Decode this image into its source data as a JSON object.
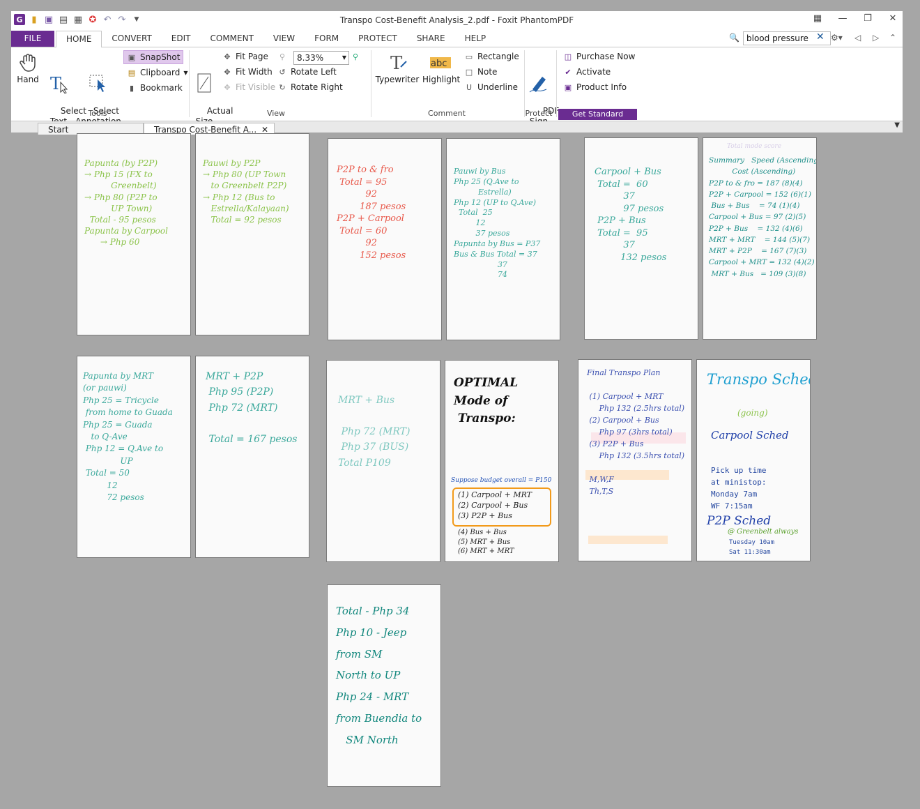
{
  "window": {
    "title": "Transpo Cost-Benefit Analysis_2.pdf - Foxit PhantomPDF",
    "app_icon": "G"
  },
  "menu": {
    "file": "FILE",
    "tabs": [
      "HOME",
      "CONVERT",
      "EDIT",
      "COMMENT",
      "VIEW",
      "FORM",
      "PROTECT",
      "SHARE",
      "HELP"
    ],
    "search_value": "blood pressure"
  },
  "ribbon": {
    "hand": "Hand",
    "select_text": "Select\nText",
    "select_annotation": "Select\nAnnotation",
    "snapshot": "SnapShot",
    "clipboard": "Clipboard",
    "bookmark": "Bookmark",
    "tools_group": "Tools",
    "actual_size": "Actual\nSize",
    "fit_page": "Fit Page",
    "fit_width": "Fit Width",
    "fit_visible": "Fit Visible",
    "zoom": "8.33%",
    "rotate_left": "Rotate Left",
    "rotate_right": "Rotate Right",
    "view_group": "View",
    "typewriter": "Typewriter",
    "highlight": "Highlight",
    "rectangle": "Rectangle",
    "note": "Note",
    "underline": "Underline",
    "comment_group": "Comment",
    "pdf_sign": "PDF\nSign",
    "protect_group": "Protect",
    "purchase_now": "Purchase Now",
    "activate": "Activate",
    "product_info": "Product Info",
    "get_standard": "Get Standard"
  },
  "doc_tabs": {
    "start": "Start",
    "document": "Transpo Cost-Benefit A..."
  },
  "pages": {
    "p1": "Papunta (by P2P)\n→ Php 15 (FX to\n          Greenbelt)\n→ Php 80 (P2P to\n          UP Town)\n  Total - 95 pesos\nPapunta by Carpool\n      → Php 60",
    "p2": "Pauwi by P2P\n→ Php 80 (UP Town\n   to Greenbelt P2P)\n→ Php 12 (Bus to\n   Estrella/Kalayaan)\n   Total = 92 pesos",
    "p3": "P2P to & fro\n Total = 95\n          92\n        187 pesos\nP2P + Carpool\n Total = 60\n          92\n        152 pesos",
    "p4": "Pauwi by Bus\nPhp 25 (Q.Ave to\n          Estrella)\nPhp 12 (UP to Q.Ave)\n  Total  25\n         12\n         37 pesos\nPapunta by Bus = P37\nBus & Bus Total = 37\n                  37\n                  74",
    "p5": "Carpool + Bus\n Total =  60\n          37\n          97 pesos\n P2P + Bus\n Total =  95\n          37\n         132 pesos",
    "p6": "Summary   Speed (Ascending)\n          Cost (Ascending)\nP2P to & fro = 187 (8)(4)\nP2P + Carpool = 152 (6)(1)\n Bus + Bus    = 74 (1)(4)\nCarpool + Bus = 97 (2)(5)\nP2P + Bus    = 132 (4)(6)\nMRT + MRT    = 144 (5)(7)\nMRT + P2P    = 167 (7)(3)\nCarpool + MRT = 132 (4)(2)\n MRT + Bus   = 109 (3)(8)",
    "p6_faded": "Total mode score",
    "p7": "Papunta by MRT\n(or pauwi)\nPhp 25 = Tricycle\n from home to Guada\nPhp 25 = Guada\n   to Q-Ave\n Php 12 = Q.Ave to\n              UP\n Total = 50\n         12\n         72 pesos",
    "p8": "MRT + P2P\n Php 95 (P2P)\n Php 72 (MRT)\n\n Total = 167 pesos",
    "p9": "MRT + Bus\n\n Php 72 (MRT)\n Php 37 (BUS)\nTotal P109",
    "p10_title": "OPTIMAL\nMode of\n Transpo:",
    "p10_budget": "Suppose budget overall = P150",
    "p10_box": "(1) Carpool + MRT\n(2) Carpool + Bus\n(3) P2P + Bus",
    "p10_rest": "(4) Bus + Bus\n(5) MRT + Bus\n(6) MRT + MRT",
    "p11": "Final Transpo Plan\n\n (1) Carpool + MRT\n     Php 132 (2.5hrs total)\n (2) Carpool + Bus\n     Php 97 (3hrs total)\n (3) P2P + Bus\n     Php 132 (3.5hrs total)\n\n M,W,F\n Th,T,S",
    "p12_title": "Transpo Sched",
    "p12_going": "(going)",
    "p12_carpool": "Carpool Sched",
    "p12_pickup": "Pick up time\nat ministop:\nMonday 7am\nWF 7:15am",
    "p12_p2p": "P2P Sched",
    "p12_greenbelt": "@ Greenbelt always",
    "p12_times": "Tuesday 10am\nSat 11:30am",
    "p13": "Total - Php 34\nPhp 10 - Jeep\nfrom SM\nNorth to UP\nPhp 24 - MRT\nfrom Buendia to\n   SM North"
  },
  "colors": {
    "brand": "#6a2c91",
    "green": "#8bc34a",
    "red": "#e8584a",
    "teal": "#3aa89b",
    "blue": "#1f4fb5",
    "orange": "#f29a1a"
  }
}
